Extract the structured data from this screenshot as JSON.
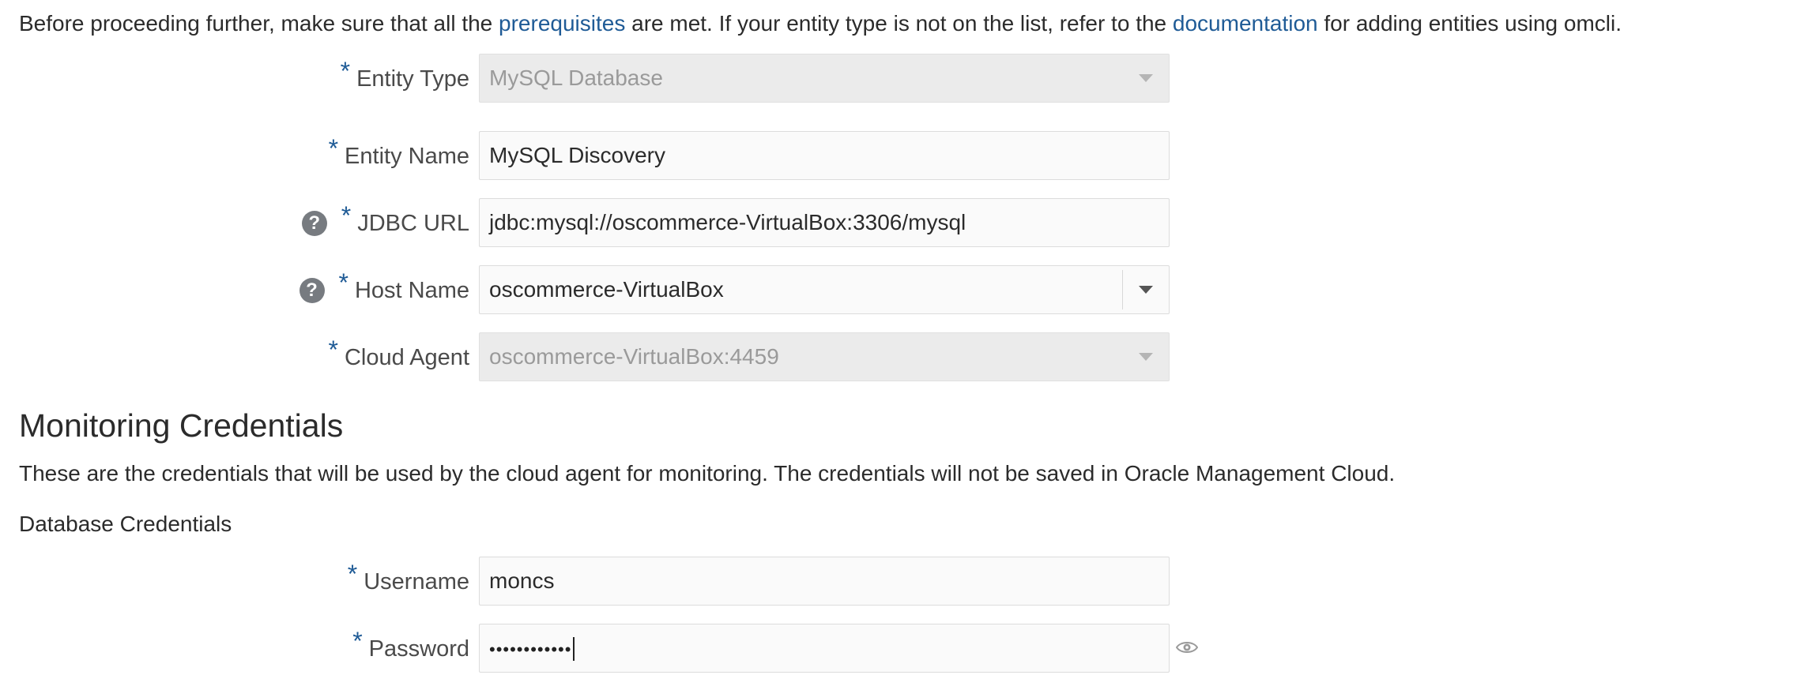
{
  "intro": {
    "text_before": "Before proceeding further, make sure that all the ",
    "link1": "prerequisites",
    "text_middle": " are met. If your entity type is not on the list, refer to the ",
    "link2": "documentation",
    "text_after": " for adding entities using omcli."
  },
  "form": {
    "required_marker": "*",
    "help_marker": "?",
    "entity_type": {
      "label": "Entity Type",
      "value": "MySQL Database",
      "disabled": true
    },
    "entity_name": {
      "label": "Entity Name",
      "value": "MySQL Discovery"
    },
    "jdbc_url": {
      "label": "JDBC URL",
      "value": "jdbc:mysql://oscommerce-VirtualBox:3306/mysql"
    },
    "host_name": {
      "label": "Host Name",
      "value": "oscommerce-VirtualBox"
    },
    "cloud_agent": {
      "label": "Cloud Agent",
      "value": "oscommerce-VirtualBox:4459",
      "disabled": true
    }
  },
  "monitoring": {
    "title": "Monitoring Credentials",
    "description": "These are the credentials that will be used by the cloud agent for monitoring. The credentials will not be saved in Oracle Management Cloud.",
    "subtitle": "Database Credentials",
    "username": {
      "label": "Username",
      "value": "moncs"
    },
    "password": {
      "label": "Password",
      "masked_value": "••••••••••••"
    }
  },
  "colors": {
    "link": "#1f5b96",
    "required": "#1f5b96",
    "help_icon_bg": "#777b80",
    "disabled_bg": "#ebebeb"
  },
  "icons": {
    "help": "help-circle-icon",
    "dropdown": "chevron-down-icon",
    "reveal": "eye-icon"
  }
}
